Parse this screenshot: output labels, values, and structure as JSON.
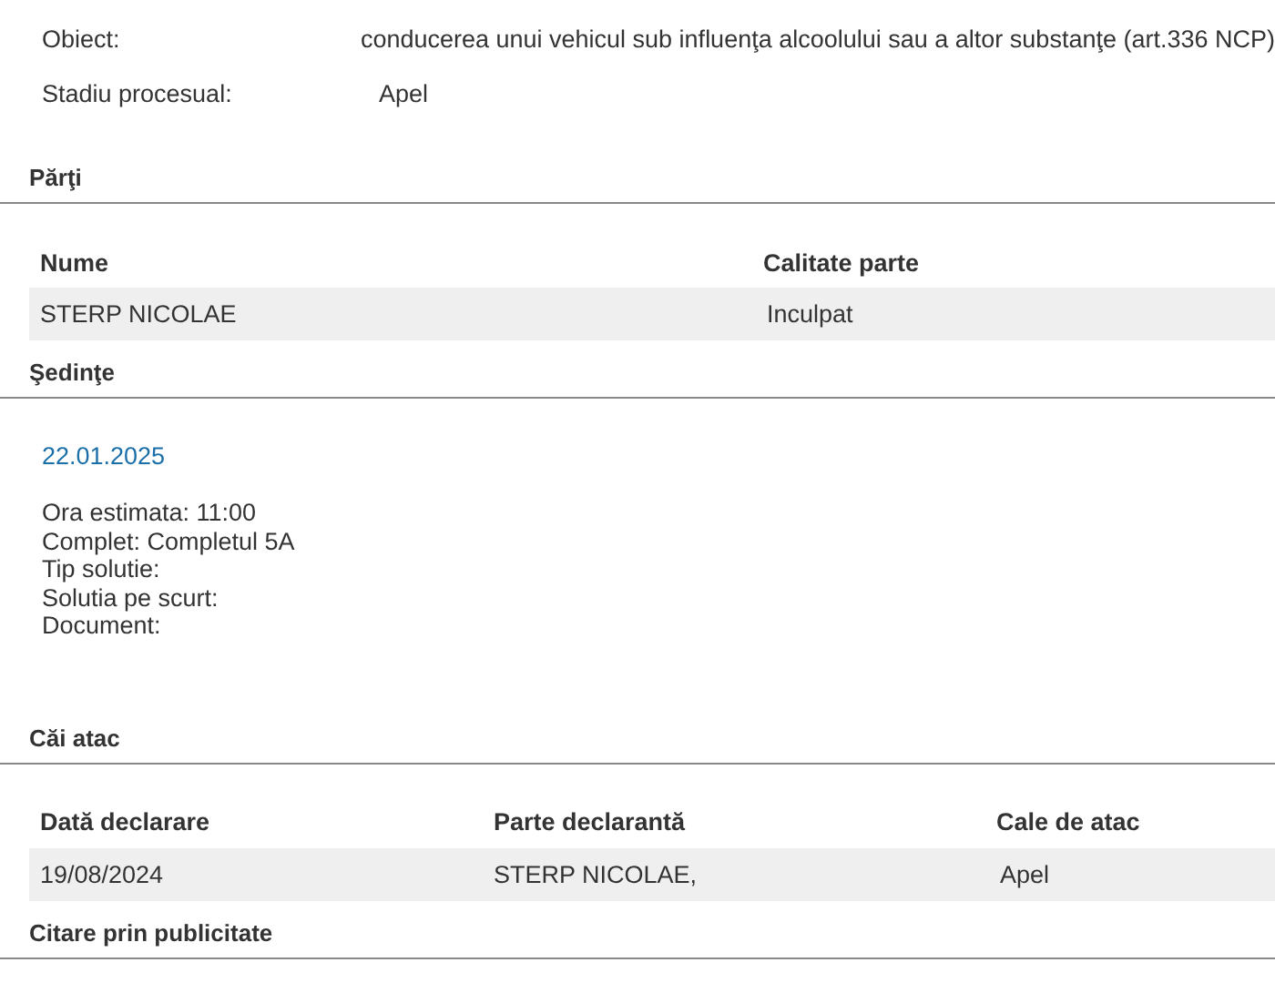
{
  "details": [
    {
      "label": "Obiect:",
      "value": "conducerea unui vehicul sub influenţa alcoolului sau a altor substanţe (art.336 NCP)"
    },
    {
      "label": "Stadiu procesual:",
      "value": "Apel"
    }
  ],
  "sections": [
    {
      "kind": "table",
      "title": "Părţi",
      "columns": [
        "Nume",
        "Calitate parte"
      ],
      "rows": [
        [
          "STERP NICOLAE",
          "Inculpat"
        ]
      ]
    },
    {
      "kind": "hearings",
      "title": "Şedinţe",
      "hearings": [
        {
          "date": "22.01.2025",
          "lines": [
            "Ora estimata: 11:00",
            "Complet: Completul 5A",
            "Tip solutie:",
            "Solutia pe scurt:",
            "Document:"
          ]
        }
      ]
    },
    {
      "kind": "table",
      "title": "Căi atac",
      "columns": [
        "Dată declarare",
        "Parte declarantă",
        "Cale de atac"
      ],
      "rows": [
        [
          "19/08/2024",
          "STERP NICOLAE,",
          "Apel"
        ]
      ]
    },
    {
      "kind": "heading",
      "title": "Citare prin publicitate"
    }
  ]
}
